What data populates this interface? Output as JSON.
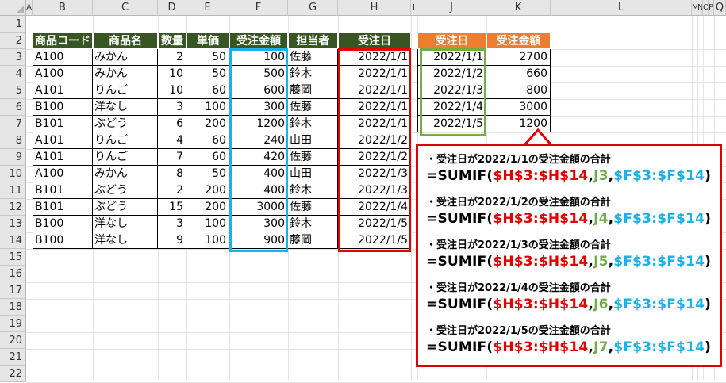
{
  "columns": [
    "A",
    "B",
    "C",
    "D",
    "E",
    "F",
    "G",
    "H",
    "I",
    "J",
    "K",
    "L",
    "M",
    "N",
    "O",
    "P",
    "Q"
  ],
  "rows": [
    "1",
    "2",
    "3",
    "4",
    "5",
    "6",
    "7",
    "8",
    "9",
    "10",
    "11",
    "12",
    "13",
    "14",
    "15",
    "16",
    "17",
    "18",
    "19",
    "20",
    "21",
    "22"
  ],
  "main_table": {
    "headers": [
      "商品コード",
      "商品名",
      "数量",
      "単価",
      "受注金額",
      "担当者",
      "受注日"
    ],
    "rows": [
      [
        "A100",
        "みかん",
        "2",
        "50",
        "100",
        "佐藤",
        "2022/1/1"
      ],
      [
        "A100",
        "みかん",
        "10",
        "50",
        "500",
        "鈴木",
        "2022/1/1"
      ],
      [
        "A101",
        "りんご",
        "10",
        "60",
        "600",
        "藤岡",
        "2022/1/1"
      ],
      [
        "B100",
        "洋なし",
        "3",
        "100",
        "300",
        "佐藤",
        "2022/1/1"
      ],
      [
        "B101",
        "ぶどう",
        "6",
        "200",
        "1200",
        "鈴木",
        "2022/1/1"
      ],
      [
        "A101",
        "りんご",
        "4",
        "60",
        "240",
        "山田",
        "2022/1/2"
      ],
      [
        "A101",
        "りんご",
        "7",
        "60",
        "420",
        "佐藤",
        "2022/1/2"
      ],
      [
        "A100",
        "みかん",
        "8",
        "50",
        "400",
        "山田",
        "2022/1/3"
      ],
      [
        "B101",
        "ぶどう",
        "2",
        "200",
        "400",
        "鈴木",
        "2022/1/3"
      ],
      [
        "B101",
        "ぶどう",
        "15",
        "200",
        "3000",
        "佐藤",
        "2022/1/4"
      ],
      [
        "B100",
        "洋なし",
        "3",
        "100",
        "300",
        "鈴木",
        "2022/1/5"
      ],
      [
        "B100",
        "洋なし",
        "9",
        "100",
        "900",
        "藤岡",
        "2022/1/5"
      ]
    ]
  },
  "summary_table": {
    "headers": [
      "受注日",
      "受注金額"
    ],
    "rows": [
      [
        "2022/1/1",
        "2700"
      ],
      [
        "2022/1/2",
        "660"
      ],
      [
        "2022/1/3",
        "800"
      ],
      [
        "2022/1/4",
        "3000"
      ],
      [
        "2022/1/5",
        "1200"
      ]
    ]
  },
  "callout": {
    "items": [
      {
        "note": "・受注日が2022/1/1の受注金額の合計",
        "pre": "=SUMIF(",
        "range": "$H$3:$H$14",
        "c1": ",",
        "crit": "J3",
        "c2": ",",
        "sum": "$F$3:$F$14",
        "post": ")"
      },
      {
        "note": "・受注日が2022/1/2の受注金額の合計",
        "pre": "=SUMIF(",
        "range": "$H$3:$H$14",
        "c1": ",",
        "crit": "J4",
        "c2": ",",
        "sum": "$F$3:$F$14",
        "post": ")"
      },
      {
        "note": "・受注日が2022/1/3の受注金額の合計",
        "pre": "=SUMIF(",
        "range": "$H$3:$H$14",
        "c1": ",",
        "crit": "J5",
        "c2": ",",
        "sum": "$F$3:$F$14",
        "post": ")"
      },
      {
        "note": "・受注日が2022/1/4の受注金額の合計",
        "pre": "=SUMIF(",
        "range": "$H$3:$H$14",
        "c1": ",",
        "crit": "J6",
        "c2": ",",
        "sum": "$F$3:$F$14",
        "post": ")"
      },
      {
        "note": "・受注日が2022/1/5の受注金額の合計",
        "pre": "=SUMIF(",
        "range": "$H$3:$H$14",
        "c1": ",",
        "crit": "J7",
        "c2": ",",
        "sum": "$F$3:$F$14",
        "post": ")"
      }
    ]
  },
  "colors": {
    "header_green": "#375623",
    "header_orange": "#ed7d31",
    "box_blue": "#1ab0e8",
    "box_red": "#e00000",
    "box_green": "#70ad47"
  }
}
